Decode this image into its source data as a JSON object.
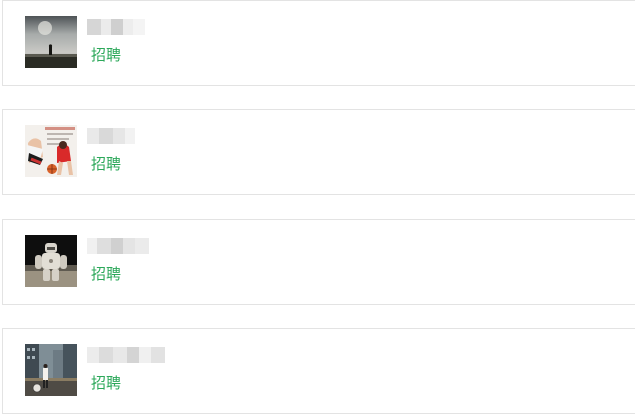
{
  "contacts": [
    {
      "tag": "招聘",
      "avatar": "avatar-landscape"
    },
    {
      "tag": "招聘",
      "avatar": "avatar-anime-basketball"
    },
    {
      "tag": "招聘",
      "avatar": "avatar-robot-figure"
    },
    {
      "tag": "招聘",
      "avatar": "avatar-city-street"
    }
  ],
  "colors": {
    "tag_green": "#2ca85a",
    "border": "#e3e3e3"
  }
}
